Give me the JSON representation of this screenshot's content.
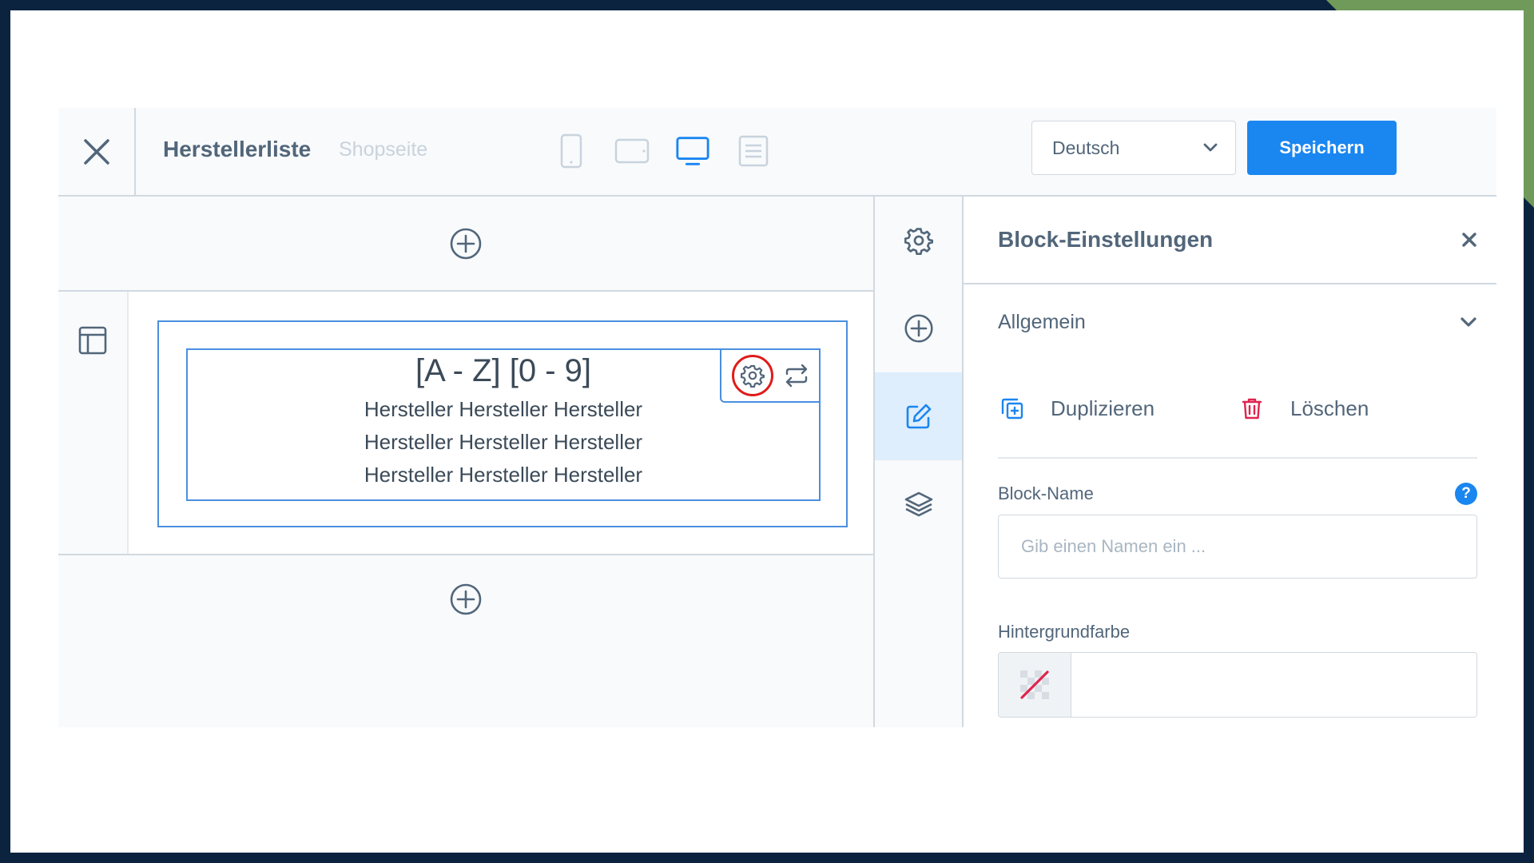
{
  "header": {
    "title": "Herstellerliste",
    "page_type": "Shopseite",
    "devices": [
      "mobile-icon",
      "tablet-icon",
      "desktop-icon",
      "list-view-icon"
    ],
    "active_device": "desktop",
    "language": "Deutsch",
    "save_label": "Speichern"
  },
  "canvas": {
    "block": {
      "heading": "[A - Z] [0 - 9]",
      "lines": [
        "Hersteller Hersteller Hersteller",
        "Hersteller Hersteller Hersteller",
        "Hersteller Hersteller Hersteller"
      ]
    }
  },
  "sidenav": {
    "items": [
      "gear-icon",
      "plus-circle-icon",
      "edit-icon",
      "layers-icon"
    ],
    "active_index": 2
  },
  "panel": {
    "title": "Block-Einstellungen",
    "section": "Allgemein",
    "duplicate_label": "Duplizieren",
    "delete_label": "Löschen",
    "block_name_label": "Block-Name",
    "block_name_placeholder": "Gib einen Namen ein ...",
    "background_label": "Hintergrundfarbe"
  },
  "colors": {
    "accent": "#1a86f0",
    "highlight": "#e01b1b",
    "delete": "#e0234e",
    "frame": "#4a8fe0"
  }
}
